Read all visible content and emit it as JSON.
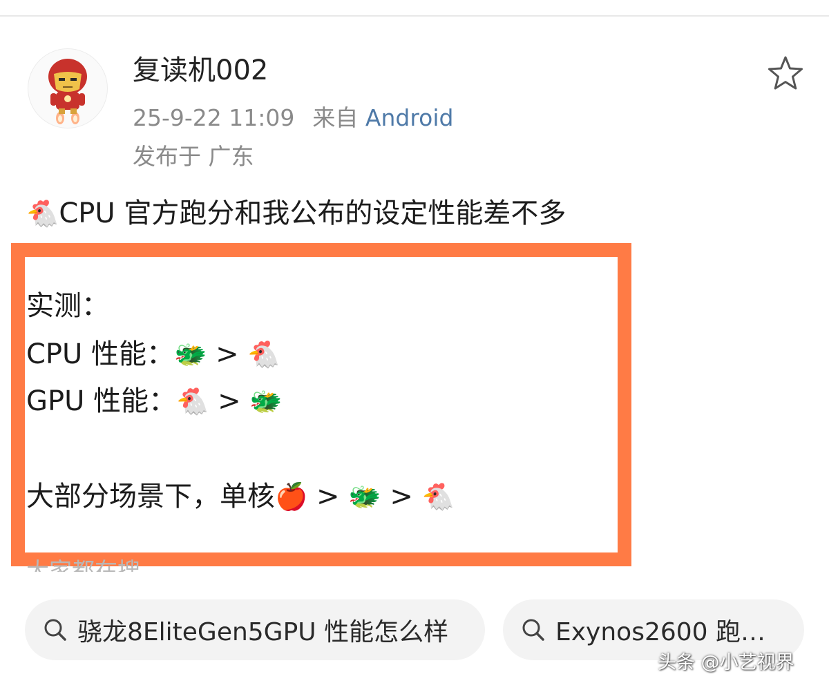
{
  "post": {
    "username": "复读机002",
    "timestamp": "25-9-22 11:09",
    "source_label": "来自",
    "source": "Android",
    "location": "发布于 广东",
    "title_emoji": "🐔",
    "title_text": "CPU 官方跑分和我公布的设定性能差不多"
  },
  "highlight": {
    "line1": "实测：",
    "cpu_label": "CPU 性能：",
    "gpu_label": "GPU 性能：",
    "summary_label": "大部分场景下，单核",
    "gt": ">",
    "emoji_dragon": "🐲",
    "emoji_chicken": "🐔",
    "emoji_apple": "🍎"
  },
  "related": {
    "label": "大家都在搜",
    "chips": [
      {
        "text": "骁龙8EliteGen5GPU 性能怎么样"
      },
      {
        "text": "Exynos2600 跑…"
      }
    ]
  },
  "watermark": "头条 @小艺视界",
  "colors": {
    "highlight_border": "#ff7b45",
    "source_link": "#4f7aa8",
    "meta_text": "#8a8a8a",
    "chip_bg": "#f3f3f3"
  },
  "icons": [
    "avatar-ironman",
    "star-icon",
    "search-icon"
  ]
}
